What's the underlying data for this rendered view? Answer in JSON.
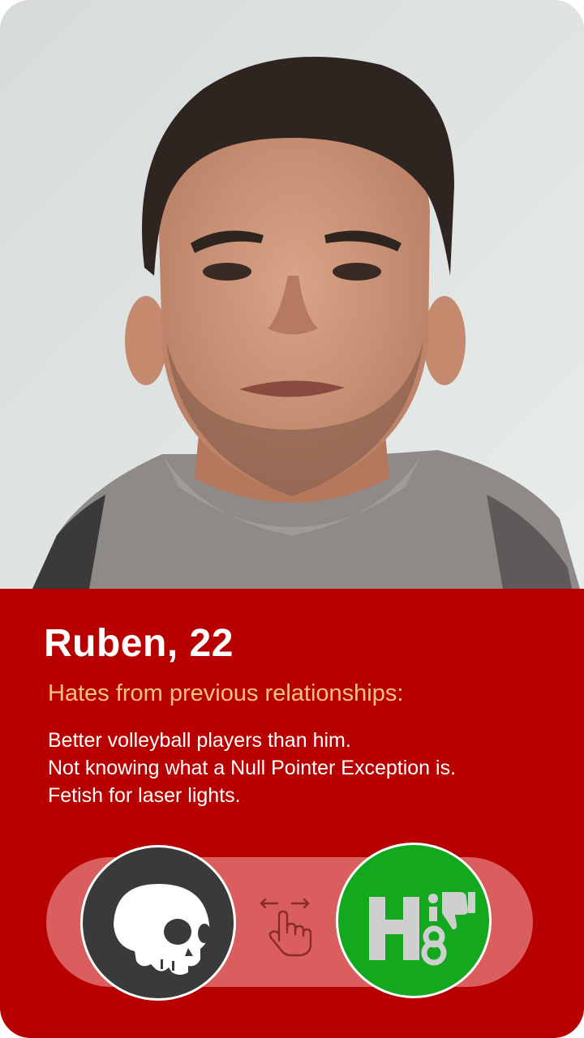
{
  "profile": {
    "name_age": "Ruben, 22",
    "hates_title": "Hates from previous relationships:",
    "hates": [
      "Better volleyball players than him.",
      "Not knowing what a Null Pointer Exception is.",
      "Fetish for laser lights."
    ]
  },
  "actions": {
    "reject_icon": "skull-icon",
    "accept_icon": "h8-thumbs-down-icon",
    "accept_logo_text": "H8",
    "swipe_hint_icon": "swipe-hand-icon"
  },
  "colors": {
    "info_background": "#b90000",
    "hates_title": "#f7c47e",
    "track": "#da5e5e",
    "reject_button": "#3a3a3a",
    "accept_button": "#14a81e"
  }
}
